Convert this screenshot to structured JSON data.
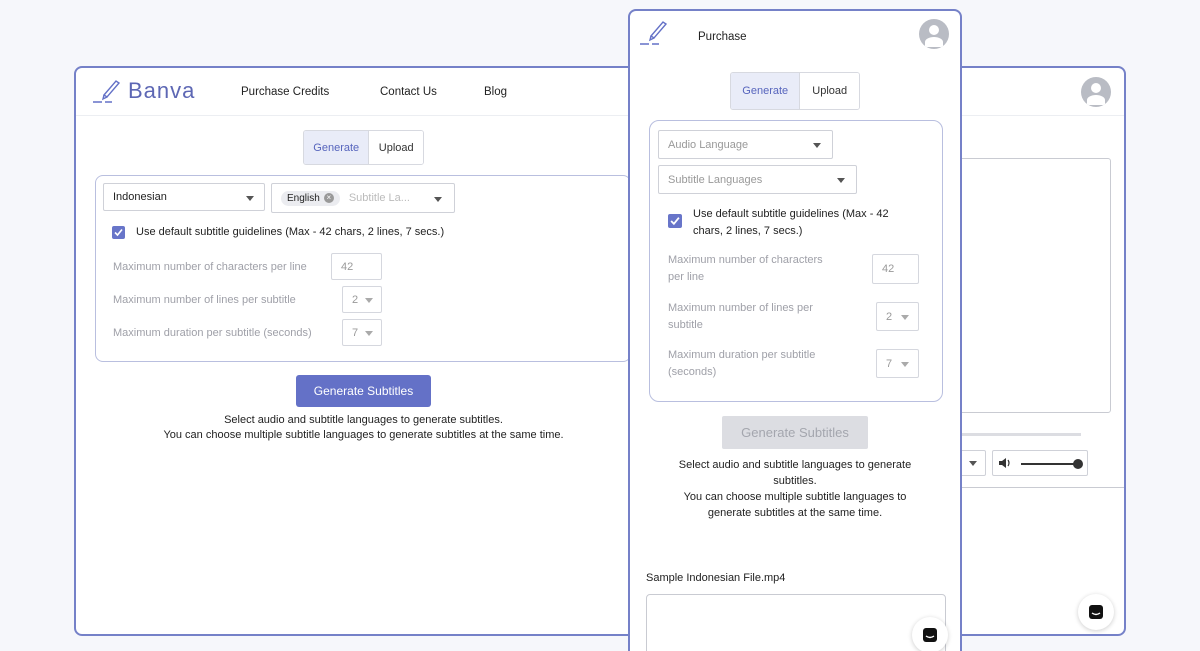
{
  "back_window": {
    "logo": "Banva",
    "nav": [
      "Purchase Credits",
      "Contact Us",
      "Blog"
    ],
    "tabs": {
      "generate": "Generate",
      "upload": "Upload"
    },
    "audio_language": "Indonesian",
    "subtitle_chip": "English",
    "subtitle_placeholder": "Subtitle La...",
    "default_guidelines_label": "Use default subtitle guidelines (Max - 42 chars, 2 lines, 7 secs.)",
    "max_chars_label": "Maximum number of characters per line",
    "max_chars_value": "42",
    "max_lines_label": "Maximum number of lines per subtitle",
    "max_lines_value": "2",
    "max_duration_label": "Maximum duration per subtitle (seconds)",
    "max_duration_value": "7",
    "generate_button": "Generate Subtitles",
    "help_line1": "Select audio and subtitle languages to generate subtitles.",
    "help_line2": "You can choose multiple subtitle languages to generate subtitles at the same time."
  },
  "mobile_window": {
    "nav_title": "Purchase",
    "tabs": {
      "generate": "Generate",
      "upload": "Upload"
    },
    "audio_language_placeholder": "Audio Language",
    "subtitle_languages_placeholder": "Subtitle Languages",
    "default_guidelines_label_1": "Use default subtitle guidelines (Max - 42",
    "default_guidelines_label_2": "chars, 2 lines, 7 secs.)",
    "max_chars_label_1": "Maximum number of characters",
    "max_chars_label_2": "per line",
    "max_chars_value": "42",
    "max_lines_label_1": "Maximum number of lines per",
    "max_lines_label_2": "subtitle",
    "max_lines_value": "2",
    "max_duration_label_1": "Maximum duration per subtitle",
    "max_duration_label_2": "(seconds)",
    "max_duration_value": "7",
    "generate_button": "Generate Subtitles",
    "help_1": "Select audio and subtitle languages to generate",
    "help_2": "subtitles.",
    "help_3": "You can choose multiple subtitle languages to",
    "help_4": "generate subtitles at the same time.",
    "sample_file": "Sample Indonesian File.mp4"
  },
  "icons": [
    "pencil-logo-icon",
    "user-avatar-icon",
    "chevron-down-icon",
    "check-icon",
    "chip-remove-icon",
    "volume-icon",
    "chat-icon"
  ],
  "colors": {
    "accent": "#6471c7",
    "frame": "#7581c8",
    "background": "#f6f7fb"
  }
}
